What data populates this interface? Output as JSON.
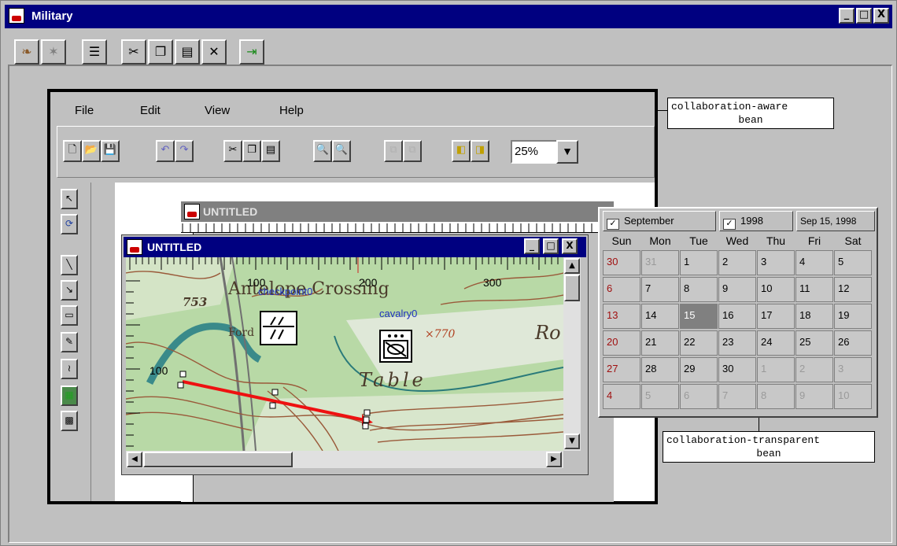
{
  "window": {
    "title": "Military",
    "controls": {
      "minimize": "_",
      "maximize": "□",
      "close": "X"
    }
  },
  "outer_toolbar": {
    "buttons": [
      {
        "name": "collaborate-icon",
        "glyph": "❧"
      },
      {
        "name": "disconnect-icon",
        "glyph": "✶"
      },
      {
        "name": "properties-icon",
        "glyph": "☰"
      },
      {
        "name": "cut-icon",
        "glyph": "✂"
      },
      {
        "name": "copy-icon",
        "glyph": "❐"
      },
      {
        "name": "paste-icon",
        "glyph": "▤"
      },
      {
        "name": "delete-icon",
        "glyph": "✕"
      },
      {
        "name": "exit-icon",
        "glyph": "⇥"
      }
    ]
  },
  "bean": {
    "menu": [
      "File",
      "Edit",
      "View",
      "Help"
    ],
    "toolbar": {
      "buttons": [
        "🗋",
        "📂",
        "💾",
        "↶",
        "↷",
        "✂",
        "❐",
        "▤",
        "🔍",
        "🔍",
        "⧉",
        "⧉",
        "◧",
        "◨"
      ],
      "zoom_value": "25%",
      "zoom_arrow": "▼"
    },
    "palette": [
      "↖",
      "⟳",
      "╲",
      "↘",
      "▭",
      "✎",
      "≀",
      "▦",
      "▩"
    ],
    "back_window_title": "UNTITLED",
    "front_window_title": "UNTITLED",
    "map": {
      "labels": {
        "crossing": "Antelope Crossing",
        "checkpoint": "checkpoint0",
        "cavalry": "cavalry0",
        "ford": "Ford",
        "table": "Table",
        "ro": "Ro",
        "n753": "753",
        "n770": "×770",
        "ruler_100": "100",
        "ruler_200": "200",
        "ruler_300": "300",
        "side_100": "100"
      }
    }
  },
  "calendar": {
    "month": "September",
    "year": "1998",
    "date_display": "Sep 15, 1998",
    "weekdays": [
      "Sun",
      "Mon",
      "Tue",
      "Wed",
      "Thu",
      "Fri",
      "Sat"
    ],
    "weeks": [
      [
        "30",
        "31",
        "1",
        "2",
        "3",
        "4",
        "5"
      ],
      [
        "6",
        "7",
        "8",
        "9",
        "10",
        "11",
        "12"
      ],
      [
        "13",
        "14",
        "15",
        "16",
        "17",
        "18",
        "19"
      ],
      [
        "20",
        "21",
        "22",
        "23",
        "24",
        "25",
        "26"
      ],
      [
        "27",
        "28",
        "29",
        "30",
        "1",
        "2",
        "3"
      ],
      [
        "4",
        "5",
        "6",
        "7",
        "8",
        "9",
        "10"
      ]
    ],
    "selected_day": "15"
  },
  "callouts": {
    "aware_line1": "collaboration-aware",
    "aware_line2": "bean",
    "transparent_line1": "collaboration-transparent",
    "transparent_line2": "bean"
  },
  "colors": {
    "title_active": "#000080",
    "title_inactive": "#808080",
    "route": "#ee1111",
    "map_green": "#b8d9a6"
  }
}
